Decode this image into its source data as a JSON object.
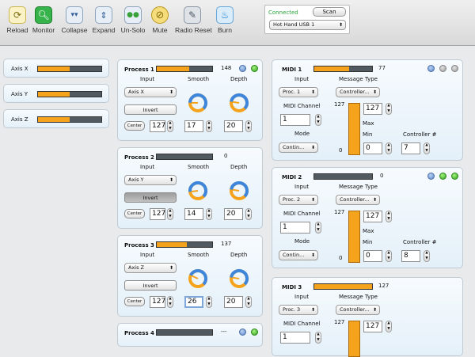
{
  "toolbar": {
    "items": [
      {
        "label": "Reload",
        "icon": "reload-icon"
      },
      {
        "label": "Monitor",
        "icon": "monitor-icon"
      },
      {
        "label": "Collapse",
        "icon": "collapse-icon"
      },
      {
        "label": "Expand",
        "icon": "expand-icon"
      },
      {
        "label": "Un-Solo",
        "icon": "unsolo-icon"
      },
      {
        "label": "Mute",
        "icon": "mute-icon"
      },
      {
        "label": "Radio Reset",
        "icon": "radio-reset-icon"
      },
      {
        "label": "Burn",
        "icon": "burn-icon"
      }
    ],
    "status": "Connected",
    "scan_label": "Scan",
    "device": "Hot Hand USB 1"
  },
  "axes": [
    {
      "label": "Axis X",
      "level": 0.5
    },
    {
      "label": "Axis Y",
      "level": 0.5
    },
    {
      "label": "Axis Z",
      "level": 0.5
    }
  ],
  "process_headers": {
    "input": "Input",
    "smooth": "Smooth",
    "depth": "Depth",
    "invert": "Invert",
    "center": "Center"
  },
  "processes": [
    {
      "title": "Process 1",
      "value": "148",
      "level": 0.58,
      "input": "Axis X",
      "invert_active": false,
      "center": "127",
      "smooth": "17",
      "depth": "20",
      "smooth_knob": 0.17,
      "depth_knob": 0.2
    },
    {
      "title": "Process 2",
      "value": "0",
      "level": 0,
      "input": "Axis Y",
      "invert_active": true,
      "center": "127",
      "smooth": "14",
      "depth": "20",
      "smooth_knob": 0.14,
      "depth_knob": 0.2
    },
    {
      "title": "Process 3",
      "value": "137",
      "level": 0.54,
      "input": "Axis Z",
      "invert_active": false,
      "center": "127",
      "smooth": "26",
      "depth": "20",
      "smooth_knob": 0.26,
      "depth_knob": 0.2
    },
    {
      "title": "Process 4",
      "value": "---",
      "level": 0
    }
  ],
  "midi_headers": {
    "input": "Input",
    "message_type": "Message Type",
    "channel": "MIDI Channel",
    "mode": "Mode",
    "max": "Max",
    "min": "Min",
    "controller": "Controller #",
    "top": "127",
    "bottom": "0"
  },
  "midis": [
    {
      "title": "MIDI 1",
      "value": "77",
      "level": 0.6,
      "input": "Proc. 1",
      "type": "Controller...",
      "channel": "1",
      "mode": "Contin...",
      "max": "127",
      "min": "0",
      "controller": "7"
    },
    {
      "title": "MIDI 2",
      "value": "0",
      "level": 0,
      "input": "Proc. 2",
      "type": "Controller...",
      "channel": "1",
      "mode": "Contin...",
      "max": "127",
      "min": "0",
      "controller": "8"
    },
    {
      "title": "MIDI 3",
      "value": "127",
      "level": 1,
      "input": "Proc. 3",
      "type": "Controller...",
      "channel": "1",
      "max": "127"
    }
  ]
}
